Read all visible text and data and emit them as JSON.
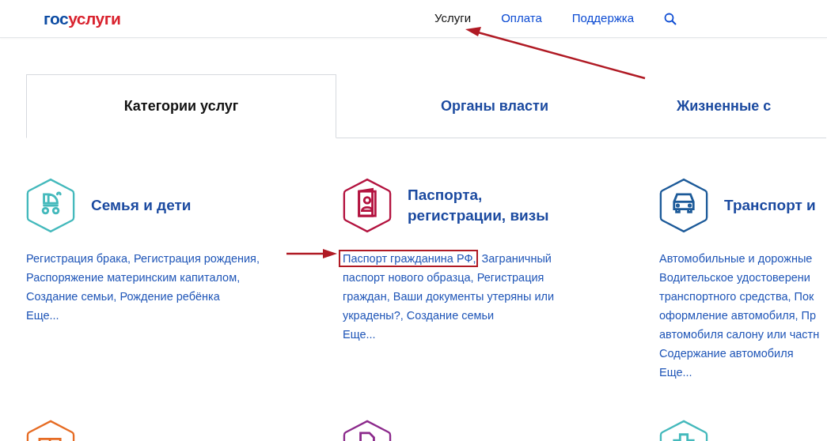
{
  "header": {
    "logo": {
      "part_1": "гос",
      "part_2": "услуги"
    },
    "nav": [
      {
        "label": "Услуги",
        "selected": true
      },
      {
        "label": "Оплата",
        "selected": false
      },
      {
        "label": "Поддержка",
        "selected": false
      }
    ]
  },
  "tabs": [
    {
      "label": "Категории услуг",
      "selected": true
    },
    {
      "label": "Органы власти",
      "selected": false
    },
    {
      "label": "Жизненные с",
      "selected": false
    }
  ],
  "categories": [
    {
      "title": "Семья и дети",
      "color": "#44b9bc",
      "lines": [
        [
          {
            "text": "Регистрация брака, Регистрация рождения,",
            "boxed": false
          }
        ],
        [
          {
            "text": "Распоряжение материнским капиталом,",
            "boxed": false
          }
        ],
        [
          {
            "text": "Создание семьи, Рождение ребёнка",
            "boxed": false
          }
        ]
      ],
      "more": "Еще..."
    },
    {
      "title": "Паспорта, регистрации, визы",
      "color": "#b3133f",
      "lines": [
        [
          {
            "text": "Паспорт гражданина РФ,",
            "boxed": true
          },
          {
            "text": " Заграничный",
            "boxed": false
          }
        ],
        [
          {
            "text": "паспорт нового образца, Регистрация",
            "boxed": false
          }
        ],
        [
          {
            "text": "граждан, Ваши документы утеряны или",
            "boxed": false
          }
        ],
        [
          {
            "text": "украдены?, Создание семьи",
            "boxed": false
          }
        ]
      ],
      "more": "Еще..."
    },
    {
      "title": "Транспорт и",
      "color": "#1c5a99",
      "lines": [
        [
          {
            "text": "Автомобильные и дорожные",
            "boxed": false
          }
        ],
        [
          {
            "text": "Водительское удостоверени",
            "boxed": false
          }
        ],
        [
          {
            "text": "транспортного средства, Пок",
            "boxed": false
          }
        ],
        [
          {
            "text": "оформление автомобиля, Пр",
            "boxed": false
          }
        ],
        [
          {
            "text": "автомобиля салону или частн",
            "boxed": false
          }
        ],
        [
          {
            "text": "Содержание автомобиля",
            "boxed": false
          }
        ]
      ],
      "more": "Еще..."
    }
  ],
  "more_categories": [
    {
      "color": "#e66c24"
    },
    {
      "color": "#8c2a8c"
    },
    {
      "color": "#44b9bc"
    }
  ]
}
